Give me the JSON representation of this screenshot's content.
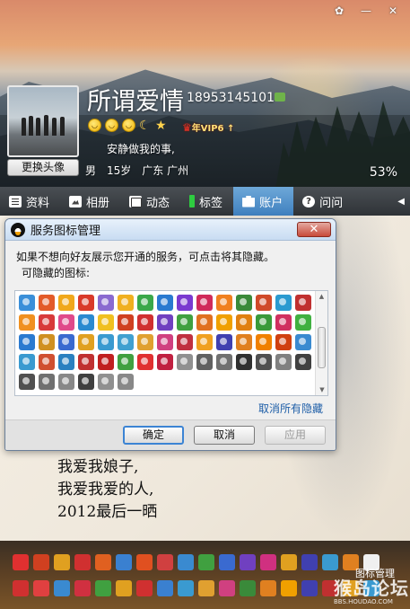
{
  "window_buttons": [
    "✿",
    "—",
    "✕"
  ],
  "profile": {
    "nickname": "所谓爱情",
    "qq_number": "18953145101",
    "vip_label": "年VIP6 ↑",
    "signature": "安静做我的事,",
    "gender": "男",
    "age": "15岁",
    "location": "广东 广州",
    "completion": "53%",
    "change_avatar_label": "更换头像",
    "status_icons": [
      "smile-icon",
      "smile-icon",
      "smile-icon",
      "moon-icon",
      "star-icon"
    ]
  },
  "tabs": [
    {
      "label": "资料",
      "icon": "profile-icon"
    },
    {
      "label": "相册",
      "icon": "album-icon"
    },
    {
      "label": "动态",
      "icon": "feed-icon"
    },
    {
      "label": "标签",
      "icon": "tag-icon"
    },
    {
      "label": "账户",
      "icon": "account-icon",
      "active": true
    },
    {
      "label": "问问",
      "icon": "question-icon"
    }
  ],
  "dialog": {
    "title": "服务图标管理",
    "description": "如果不想向好友展示您开通的服务，可点击将其隐藏。",
    "hidden_label": "可隐藏的图标:",
    "unhide_all": "取消所有隐藏",
    "ok": "确定",
    "cancel": "取消",
    "apply": "应用",
    "close": "✕",
    "icon_colors": [
      "#3a8fd9",
      "#e35b2a",
      "#f0a81c",
      "#d93a2a",
      "#8a6ad0",
      "#f0b020",
      "#3aa84a",
      "#2a7ad0",
      "#7a3ad0",
      "#d02a5a",
      "#f08020",
      "#3a8a3a",
      "#d04a2a",
      "#2a9ad0",
      "#c03030",
      "#f09020",
      "#d83a3a",
      "#e04a8a",
      "#2a8ad0",
      "#f0c020",
      "#d04020",
      "#d03030",
      "#7040c0",
      "#40a040",
      "#e07020",
      "#f0a000",
      "#e08010",
      "#3a9a3a",
      "#d03060",
      "#40b040",
      "#2a7ad0",
      "#d09020",
      "#3a6ad0",
      "#e0a020",
      "#3a9ad0",
      "#40a0d0",
      "#e0a030",
      "#d04080",
      "#c03040",
      "#f0a020",
      "#4040b0",
      "#e08020",
      "#f08000",
      "#d04010",
      "#3a8ad0",
      "#3a9ad0",
      "#d05030",
      "#2a80c0",
      "#c03030",
      "#c02020",
      "#40a040",
      "#e03030",
      "#c02040",
      "#909090",
      "#606060",
      "#707070",
      "#303030",
      "#505050",
      "#808080",
      "#404040",
      "#505050",
      "#707070",
      "#888888",
      "#404040",
      "#909090",
      "#888888"
    ]
  },
  "poem": [
    "我爱我娘子,",
    "我爱我爱的人,",
    "2012最后一晒"
  ],
  "bottom_bar": {
    "label": "图标管理",
    "watermark": "猴岛论坛",
    "watermark_url": "BBS.HOUDAO.COM",
    "row1_colors": [
      "#e03030",
      "#d04020",
      "#e0a020",
      "#d03030",
      "#e06020",
      "#3a80d0",
      "#e05020",
      "#d04040",
      "#3a8ad0",
      "#40a040",
      "#3a6ad0",
      "#7040c0",
      "#d03080",
      "#e0a020",
      "#4040b0",
      "#3a9ad0",
      "#e08020",
      "#f0f0f0"
    ],
    "row2_colors": [
      "#d03030",
      "#e04040",
      "#3a8ad0",
      "#d03040",
      "#40a040",
      "#e0a020",
      "#d03030",
      "#3a80d0",
      "#3a9ad0",
      "#e0a030",
      "#d04080",
      "#3a8a3a",
      "#e08020",
      "#f0a000",
      "#4040b0",
      "#c03030",
      "#e0a020",
      "#3a9ad0"
    ]
  }
}
